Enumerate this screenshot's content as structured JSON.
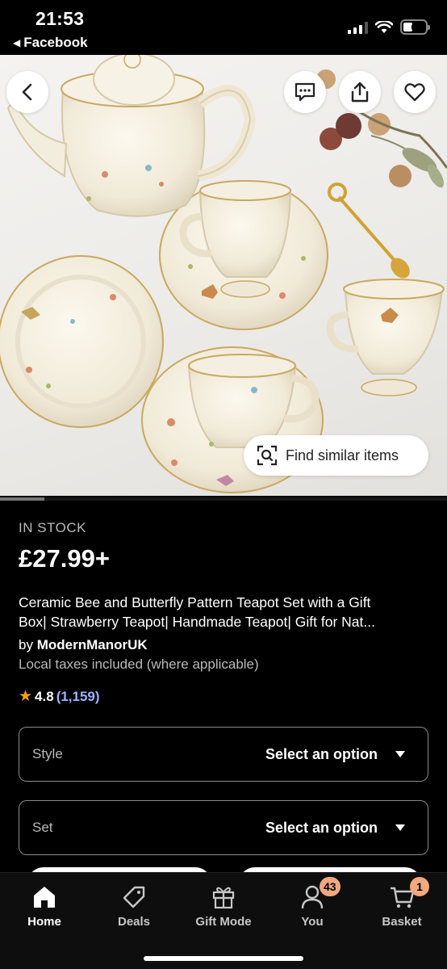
{
  "status_bar": {
    "time": "21:53",
    "back_app": "Facebook",
    "battery": "6"
  },
  "hero": {
    "find_similar_label": "Find similar items",
    "icons": [
      "back-arrow-icon",
      "message-icon",
      "share-icon",
      "heart-icon",
      "camera-search-icon"
    ]
  },
  "product": {
    "stock": "IN STOCK",
    "price": "£27.99+",
    "title_line1": "Ceramic Bee and Butterfly Pattern Teapot Set with a Gift",
    "title_line2": "Box| Strawberry Teapot| Handmade Teapot| Gift for Nat...",
    "seller_prefix": "by ",
    "seller_name": "ModernManorUK",
    "taxes": "Local taxes included (where applicable)",
    "rating_value": "4.8",
    "rating_count": "(1,159)"
  },
  "options": [
    {
      "label": "Style",
      "value": "Select an option"
    },
    {
      "label": "Set",
      "value": "Select an option"
    }
  ],
  "nav": {
    "items": [
      {
        "label": "Home",
        "icon": "home-icon",
        "active": true
      },
      {
        "label": "Deals",
        "icon": "tag-icon"
      },
      {
        "label": "Gift Mode",
        "icon": "gift-icon"
      },
      {
        "label": "You",
        "icon": "person-icon",
        "badge": "43"
      },
      {
        "label": "Basket",
        "icon": "cart-icon",
        "badge": "1"
      }
    ]
  },
  "colors": {
    "background": "#000000",
    "accent_star": "#f1a10d",
    "link_blue": "#9db4ff",
    "badge": "#f1a87f"
  }
}
